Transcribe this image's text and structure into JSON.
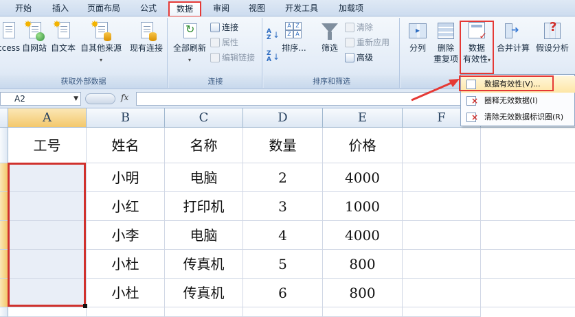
{
  "ribbon_tabs": [
    "开始",
    "插入",
    "页面布局",
    "公式",
    "数据",
    "审阅",
    "视图",
    "开发工具",
    "加载项"
  ],
  "active_tab": "数据",
  "groups": {
    "external": {
      "label": "获取外部数据",
      "access": "ccess",
      "web": "自网站",
      "text": "自文本",
      "other": "自其他来源",
      "existing": "现有连接"
    },
    "connections": {
      "label": "连接",
      "refresh_all": "全部刷新",
      "connections": "连接",
      "properties": "属性",
      "edit_links": "编辑链接"
    },
    "sort_filter": {
      "label": "排序和筛选",
      "sort": "排序...",
      "filter": "筛选",
      "clear": "清除",
      "reapply": "重新应用",
      "advanced": "高级"
    },
    "data_tools": {
      "split": "分列",
      "remove_dup_1": "删除",
      "remove_dup_2": "重复项",
      "validation_1": "数据",
      "validation_2": "有效性",
      "consolidate": "合并计算",
      "whatif": "假设分析"
    }
  },
  "formula_bar": {
    "name_box": "A2",
    "fx": "fx",
    "content": ""
  },
  "sheet": {
    "columns": [
      "A",
      "B",
      "C",
      "D",
      "E",
      "F"
    ],
    "selected_column": "A",
    "headers": [
      "工号",
      "姓名",
      "名称",
      "数量",
      "价格",
      ""
    ],
    "rows": [
      [
        "",
        "小明",
        "电脑",
        "2",
        "4000",
        ""
      ],
      [
        "",
        "小红",
        "打印机",
        "3",
        "1000",
        ""
      ],
      [
        "",
        "小李",
        "电脑",
        "4",
        "4000",
        ""
      ],
      [
        "",
        "小杜",
        "传真机",
        "5",
        "800",
        ""
      ],
      [
        "",
        "小杜",
        "传真机",
        "6",
        "800",
        ""
      ]
    ]
  },
  "validation_menu": {
    "items": [
      "数据有效性(V)...",
      "圈释无效数据(I)",
      "清除无效数据标识圈(R)"
    ],
    "highlighted_index": 0
  },
  "colors": {
    "annotation_red": "#e53935",
    "ribbon_bg": "#e3ecf7",
    "selection_header": "#f3c86c"
  }
}
